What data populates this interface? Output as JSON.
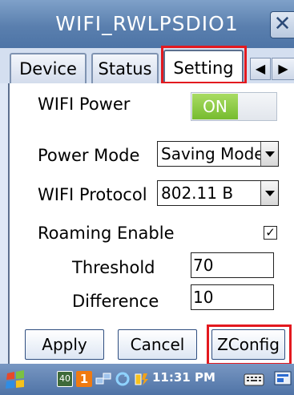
{
  "window": {
    "title": "WIFI_RWLPSDIO1",
    "close_glyph": "✕"
  },
  "tabs": [
    {
      "label": "Device",
      "selected": false
    },
    {
      "label": "Status",
      "selected": false
    },
    {
      "label": "Setting",
      "selected": true
    }
  ],
  "tab_scroll": {
    "left_glyph": "◀",
    "right_glyph": "▶"
  },
  "settings": {
    "wifi_power": {
      "label": "WIFI Power",
      "value": "ON"
    },
    "power_mode": {
      "label": "Power Mode",
      "value": "Saving Mode"
    },
    "wifi_protocol": {
      "label": "WIFI Protocol",
      "value": "802.11 B"
    },
    "roaming": {
      "label": "Roaming Enable",
      "checked": true,
      "check_glyph": "✓"
    },
    "threshold": {
      "label": "Threshold",
      "value": "70"
    },
    "difference": {
      "label": "Difference",
      "value": "10"
    }
  },
  "buttons": {
    "apply": "Apply",
    "cancel": "Cancel",
    "zconfig": "ZConfig"
  },
  "taskbar": {
    "tray_signal": "40",
    "tray_badge": "1",
    "clock": "11:31 PM"
  },
  "colors": {
    "highlight": "#e3191f",
    "toggle_on": "#76bc2f",
    "titlebar": "#5a7fae"
  }
}
